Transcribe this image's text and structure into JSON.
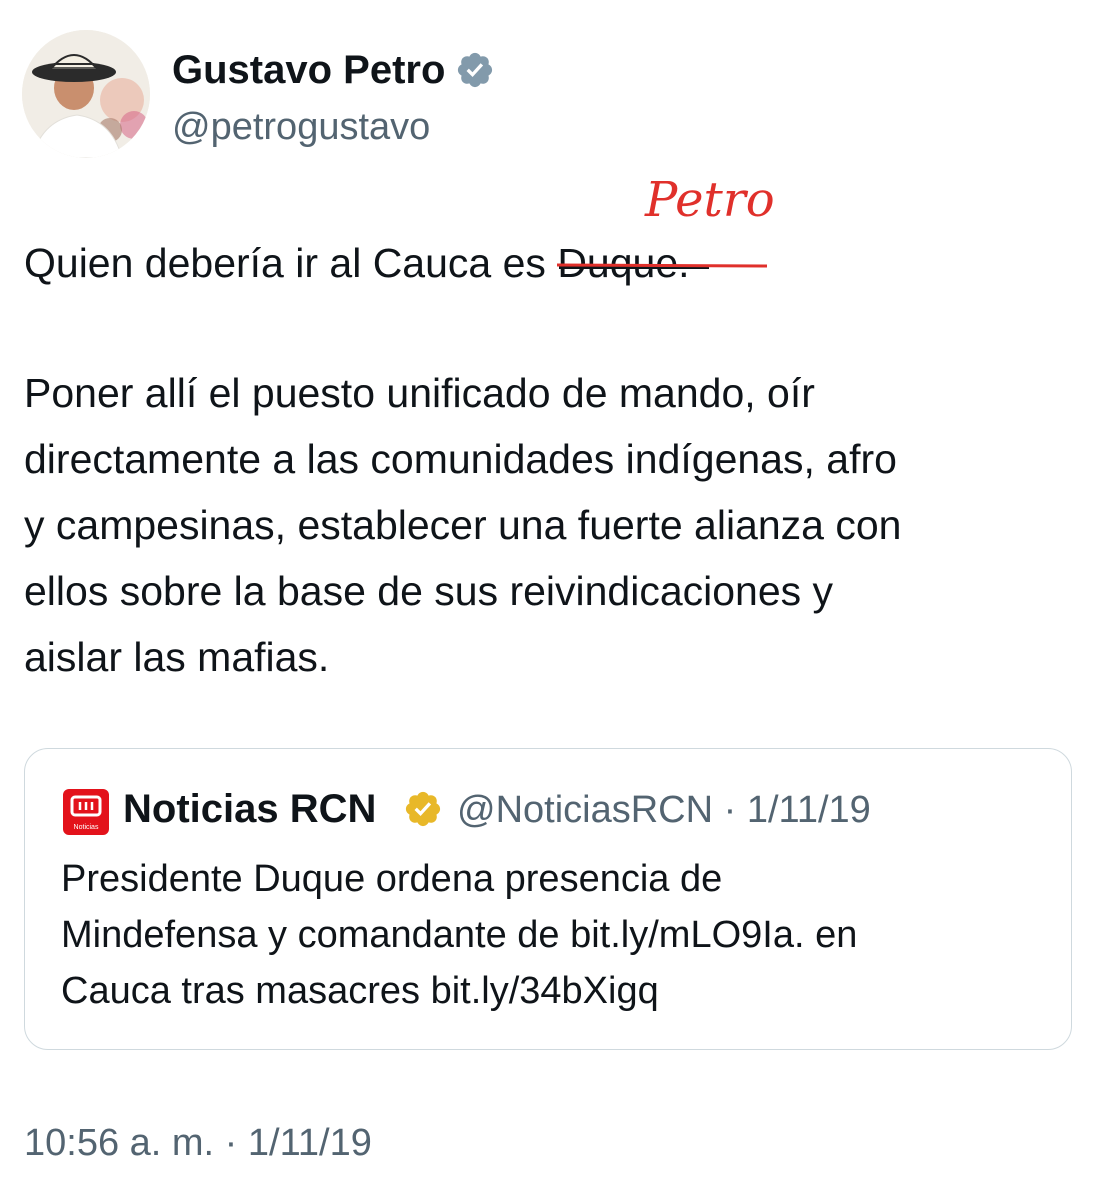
{
  "author": {
    "name": "Gustavo Petro",
    "handle": "@petrogustavo",
    "verified_color": "#829aab"
  },
  "annotation": {
    "handwritten_text": "Petro",
    "color": "#e0302b"
  },
  "tweet": {
    "line1_prefix": "Quien debería ir al  Cauca es ",
    "line1_struck": "Duque.",
    "paragraph2_lines": [
      "Poner allí el puesto unificado de mando, oír",
      "directamente a las comunidades indígenas, afro",
      "y campesinas, establecer una fuerte alianza con",
      "ellos sobre la base de sus reivindicaciones y",
      "aislar las mafias."
    ],
    "timestamp": "10:56 a. m. · 1/11/19"
  },
  "quoted_tweet": {
    "logo_text": "Noticias",
    "name": "Noticias RCN",
    "meta": "@NoticiasRCN · 1/11/19",
    "verified_color": "#e8b829",
    "text_lines": [
      "Presidente Duque ordena presencia de",
      "Mindefensa y comandante de bit.ly/mLO9Ia. en",
      "Cauca tras masacres bit.ly/34bXigq"
    ]
  }
}
